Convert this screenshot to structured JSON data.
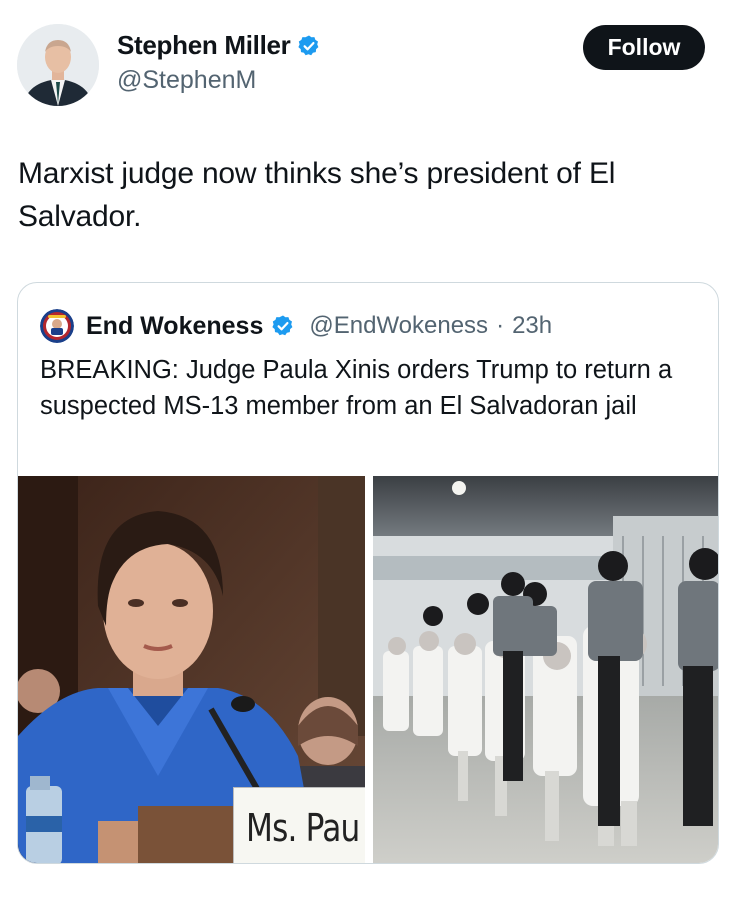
{
  "author": {
    "display_name": "Stephen Miller",
    "handle": "@StephenM",
    "verified_icon": "verified-badge-icon",
    "follow_label": "Follow"
  },
  "tweet": {
    "text": "Marxist judge now thinks she’s president of El Salvador."
  },
  "quoted": {
    "display_name": "End Wokeness",
    "handle": "@EndWokeness",
    "separator": "·",
    "time": "23h",
    "text": "BREAKING: Judge Paula Xinis orders Trump to return a suspected MS-13 member from an El Salvadoran jail",
    "media": {
      "left_image": "photo of judge at hearing",
      "nameplate_text": "Ms. Pau",
      "right_image": "photo of prisoners escorted by masked guards"
    }
  },
  "colors": {
    "text": "#0f1419",
    "secondary": "#536471",
    "verified": "#1d9bf0",
    "border": "#cfd9de",
    "button_bg": "#0f1419"
  }
}
